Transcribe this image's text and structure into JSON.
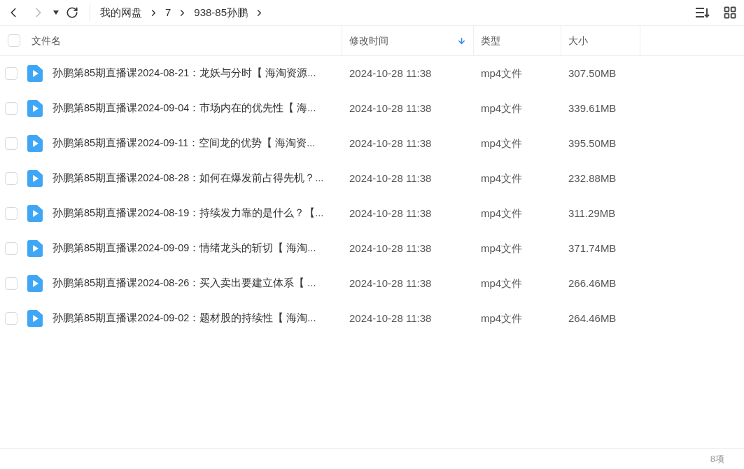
{
  "breadcrumb": [
    "我的网盘",
    "7",
    "938-85孙鹏"
  ],
  "table": {
    "select_all": {
      "checked": false
    },
    "columns": [
      {
        "label": "文件名",
        "sorted": false
      },
      {
        "label": "修改时间",
        "sorted": true
      },
      {
        "label": "类型",
        "sorted": false
      },
      {
        "label": "大小",
        "sorted": false
      }
    ],
    "rows": [
      {
        "checked": false,
        "name": "孙鹏第85期直播课2024-08-21：龙妖与分时【 海淘资源...",
        "modified": "2024-10-28 11:38",
        "type": "mp4文件",
        "size": "307.50MB"
      },
      {
        "checked": false,
        "name": "孙鹏第85期直播课2024-09-04：市场内在的优先性【 海...",
        "modified": "2024-10-28 11:38",
        "type": "mp4文件",
        "size": "339.61MB"
      },
      {
        "checked": false,
        "name": "孙鹏第85期直播课2024-09-11：空间龙的优势【 海淘资...",
        "modified": "2024-10-28 11:38",
        "type": "mp4文件",
        "size": "395.50MB"
      },
      {
        "checked": false,
        "name": "孙鹏第85期直播课2024-08-28：如何在爆发前占得先机？...",
        "modified": "2024-10-28 11:38",
        "type": "mp4文件",
        "size": "232.88MB"
      },
      {
        "checked": false,
        "name": "孙鹏第85期直播课2024-08-19：持续发力靠的是什么？【...",
        "modified": "2024-10-28 11:38",
        "type": "mp4文件",
        "size": "311.29MB"
      },
      {
        "checked": false,
        "name": "孙鹏第85期直播课2024-09-09：情绪龙头的斩切【 海淘...",
        "modified": "2024-10-28 11:38",
        "type": "mp4文件",
        "size": "371.74MB"
      },
      {
        "checked": false,
        "name": "孙鹏第85期直播课2024-08-26：买入卖出要建立体系【 ...",
        "modified": "2024-10-28 11:38",
        "type": "mp4文件",
        "size": "266.46MB"
      },
      {
        "checked": false,
        "name": "孙鹏第85期直播课2024-09-02：题材股的持续性【 海淘...",
        "modified": "2024-10-28 11:38",
        "type": "mp4文件",
        "size": "264.46MB"
      }
    ]
  },
  "status_bar": {
    "count": "8项"
  }
}
